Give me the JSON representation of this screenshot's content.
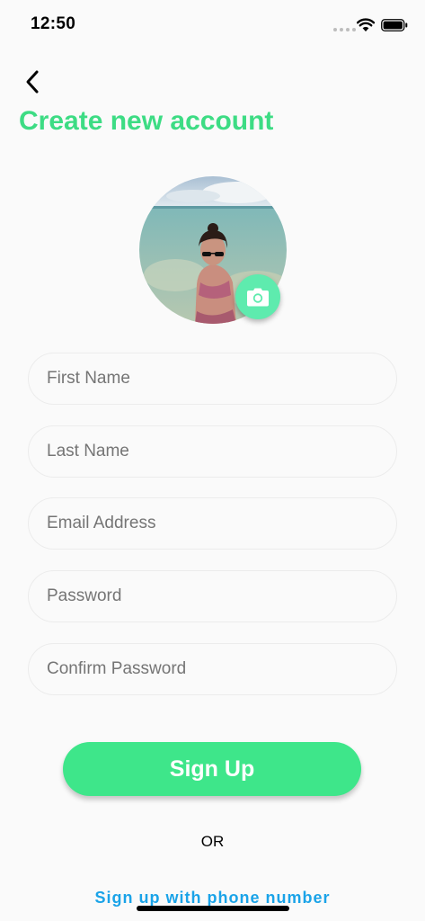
{
  "status_bar": {
    "time": "12:50",
    "icons": [
      "signal-dots-icon",
      "wifi-icon",
      "battery-icon"
    ]
  },
  "header": {
    "back_icon": "chevron-left-icon",
    "title": "Create new account"
  },
  "avatar": {
    "description_icon": "profile-photo",
    "camera_icon": "camera-icon"
  },
  "form": {
    "first_name_placeholder": "First Name",
    "last_name_placeholder": "Last Name",
    "email_placeholder": "Email Address",
    "password_placeholder": "Password",
    "confirm_password_placeholder": "Confirm Password"
  },
  "actions": {
    "sign_up_label": "Sign Up",
    "or_label": "OR",
    "phone_link_label": "Sign up with phone number"
  },
  "colors": {
    "accent_green": "#3ddc84",
    "camera_green": "#5eebae",
    "link_blue": "#1aa3e8"
  }
}
